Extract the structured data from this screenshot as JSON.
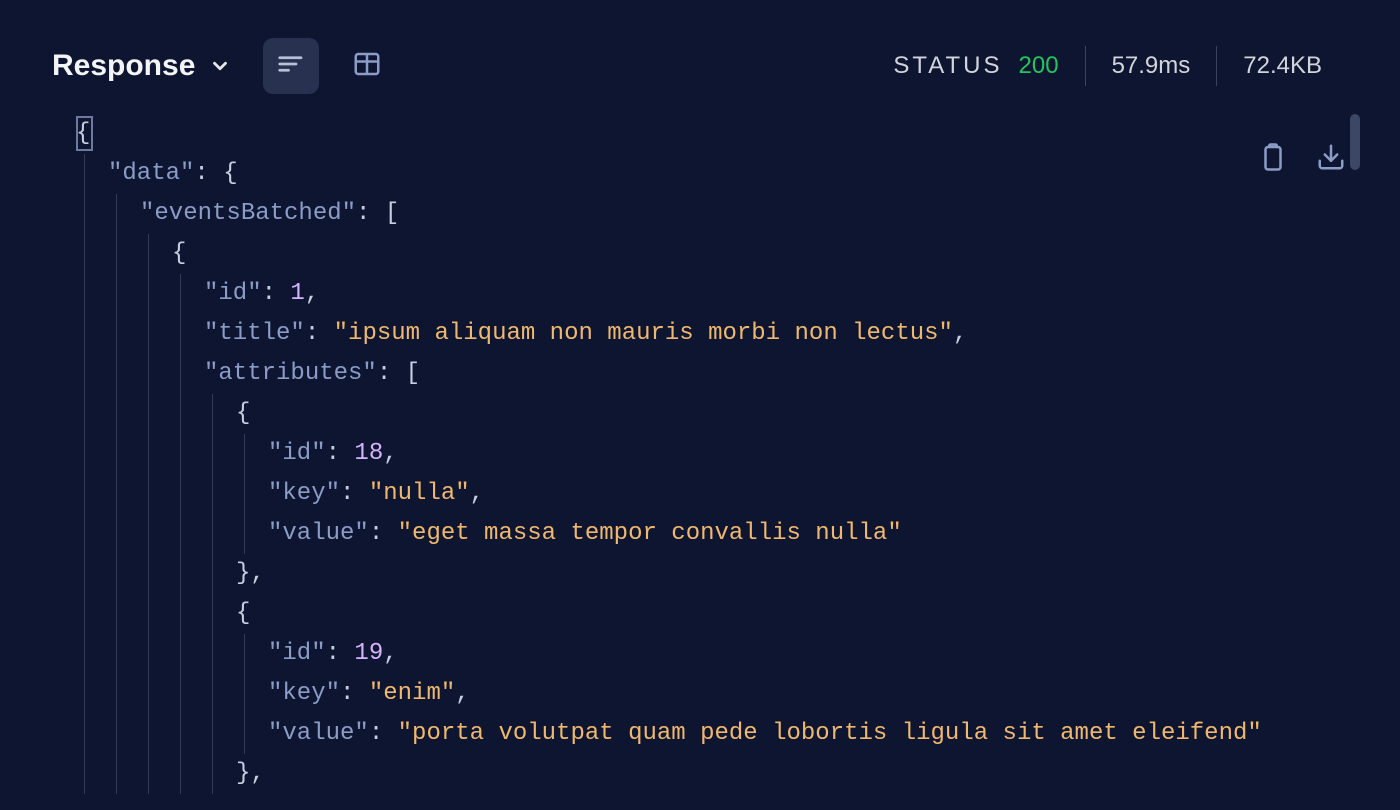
{
  "header": {
    "title": "Response",
    "status_label": "STATUS",
    "status_code": "200",
    "time": "57.9ms",
    "size": "72.4KB"
  },
  "code": {
    "l0_open": "{",
    "l1_key": "\"data\"",
    "l1_punc": ": {",
    "l2_key": "\"eventsBatched\"",
    "l2_punc": ": [",
    "l3_open": "{",
    "l4_key": "\"id\"",
    "l4_punc1": ": ",
    "l4_val": "1",
    "l4_punc2": ",",
    "l5_key": "\"title\"",
    "l5_punc1": ": ",
    "l5_val": "\"ipsum aliquam non mauris morbi non lectus\"",
    "l5_punc2": ",",
    "l6_key": "\"attributes\"",
    "l6_punc": ": [",
    "l7_open": "{",
    "l8_key": "\"id\"",
    "l8_punc1": ": ",
    "l8_val": "18",
    "l8_punc2": ",",
    "l9_key": "\"key\"",
    "l9_punc1": ": ",
    "l9_val": "\"nulla\"",
    "l9_punc2": ",",
    "l10_key": "\"value\"",
    "l10_punc1": ": ",
    "l10_val": "\"eget massa tempor convallis nulla\"",
    "l11_close": "},",
    "l12_open": "{",
    "l13_key": "\"id\"",
    "l13_punc1": ": ",
    "l13_val": "19",
    "l13_punc2": ",",
    "l14_key": "\"key\"",
    "l14_punc1": ": ",
    "l14_val": "\"enim\"",
    "l14_punc2": ",",
    "l15_key": "\"value\"",
    "l15_punc1": ": ",
    "l15_val": "\"porta volutpat quam pede lobortis ligula sit amet eleifend\"",
    "l16_close": "},"
  }
}
